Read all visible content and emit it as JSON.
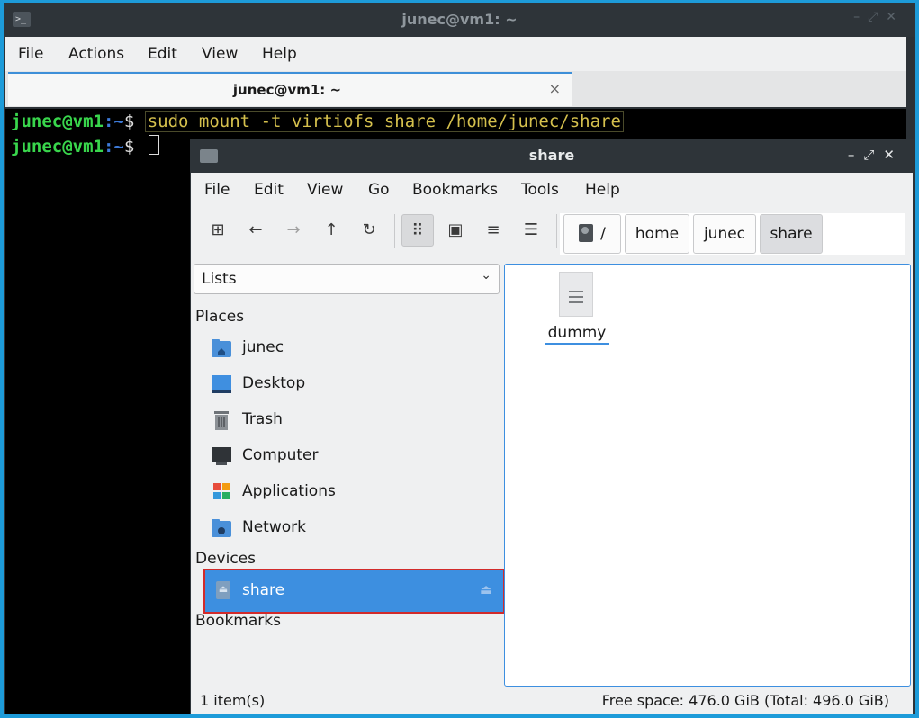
{
  "terminal": {
    "title": "junec@vm1: ~",
    "menu": [
      "File",
      "Actions",
      "Edit",
      "View",
      "Help"
    ],
    "tab_label": "junec@vm1: ~",
    "tab_close": "×",
    "lines": [
      {
        "user": "junec@vm1",
        "path": ":~",
        "sym": "$ ",
        "cmd": "sudo mount -t virtiofs share /home/junec/share"
      },
      {
        "user": "junec@vm1",
        "path": ":~",
        "sym": "$ ",
        "cmd": ""
      }
    ]
  },
  "filemanager": {
    "title": "share",
    "menu": [
      "File",
      "Edit",
      "View",
      "Go",
      "Bookmarks",
      "Tools",
      "Help"
    ],
    "path": {
      "root": "/",
      "crumbs": [
        "home",
        "junec",
        "share"
      ]
    },
    "side": {
      "mode": "Lists",
      "places_heading": "Places",
      "places": [
        "junec",
        "Desktop",
        "Trash",
        "Computer",
        "Applications",
        "Network"
      ],
      "devices_heading": "Devices",
      "devices": [
        "share"
      ],
      "bookmarks_heading": "Bookmarks"
    },
    "files": [
      {
        "name": "dummy",
        "icon": "text-file-icon"
      }
    ],
    "status": {
      "items": "1 item(s)",
      "free": "Free space: 476.0 GiB (Total: 496.0 GiB)"
    }
  },
  "colors": {
    "desktop": "#1d9bd9",
    "accent": "#3d8fe0",
    "prompt_user": "#39d64c",
    "prompt_path": "#3d7ad8",
    "command": "#d5c04d",
    "highlight_outline": "#d22b2b"
  }
}
